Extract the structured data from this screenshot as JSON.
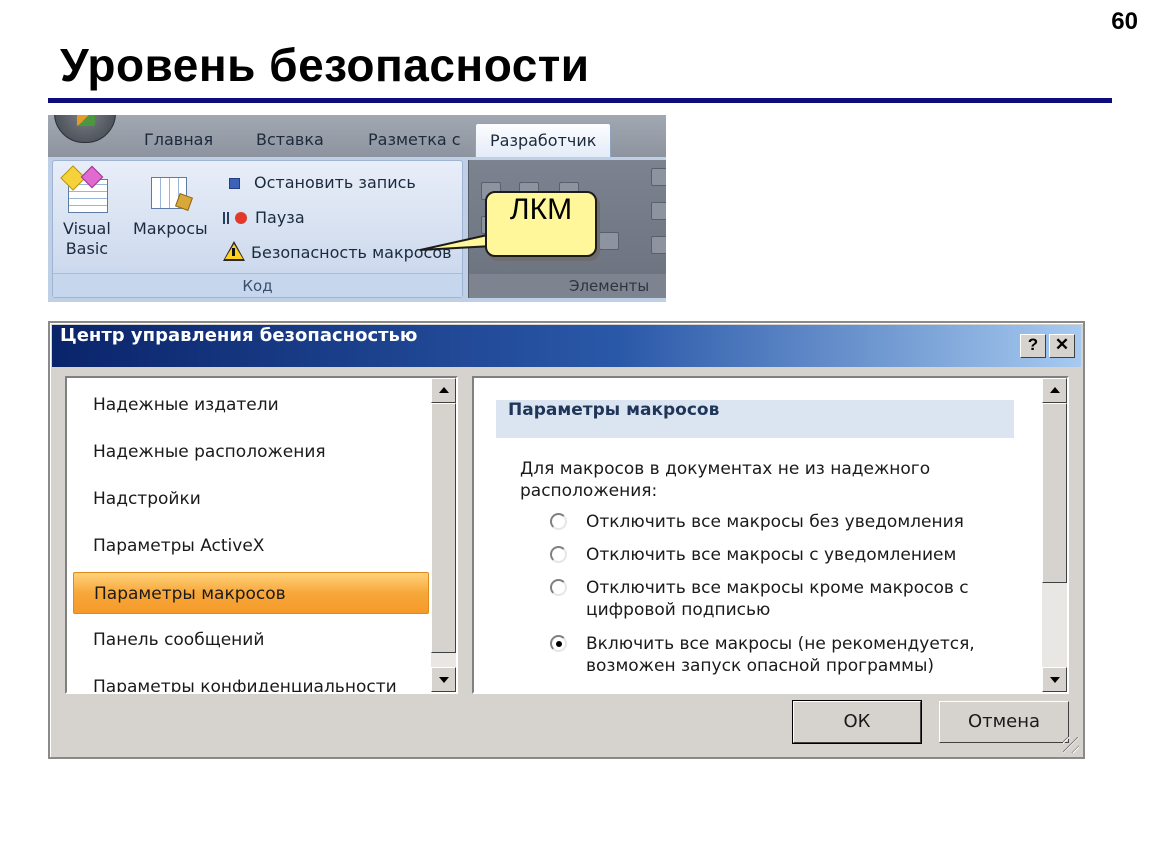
{
  "slide": {
    "page_number": "60",
    "title": "Уровень безопасности"
  },
  "ribbon": {
    "tabs": [
      "Главная",
      "Вставка",
      "Разметка с",
      "Разработчик"
    ],
    "active_tab": "Разработчик",
    "code_group": {
      "label": "Код",
      "visual_basic_line1": "Visual",
      "visual_basic_line2": "Basic",
      "macros_label": "Макросы",
      "stop_recording": "Остановить запись",
      "pause": "Пауза",
      "macro_security": "Безопасность макросов"
    },
    "controls_group_label": "Элементы"
  },
  "callout": {
    "text": "ЛКМ"
  },
  "dialog": {
    "title": "Центр управления безопасностью",
    "help_glyph": "?",
    "close_glyph": "✕",
    "nav_items": [
      "Надежные издатели",
      "Надежные расположения",
      "Надстройки",
      "Параметры ActiveX",
      "Параметры макросов",
      "Панель сообщений",
      "Параметры конфиденциальности"
    ],
    "selected_nav": "Параметры макросов",
    "section_header": "Параметры макросов",
    "intro_text": "Для макросов в документах не из надежного расположения:",
    "options": [
      {
        "label": "Отключить все макросы без уведомления",
        "checked": false
      },
      {
        "label": "Отключить все макросы с уведомлением",
        "checked": false
      },
      {
        "label": "Отключить все макросы кроме макросов с цифровой подписью",
        "checked": false
      },
      {
        "label": "Включить все макросы (не рекомендуется, возможен запуск опасной программы)",
        "checked": true
      }
    ],
    "ok_label": "ОК",
    "cancel_label": "Отмена"
  },
  "colors": {
    "title_rule": "#0c0c7a",
    "selected_item": "#f7a73a",
    "callout_fill": "#fff79a",
    "titlebar_start": "#0a246a"
  }
}
